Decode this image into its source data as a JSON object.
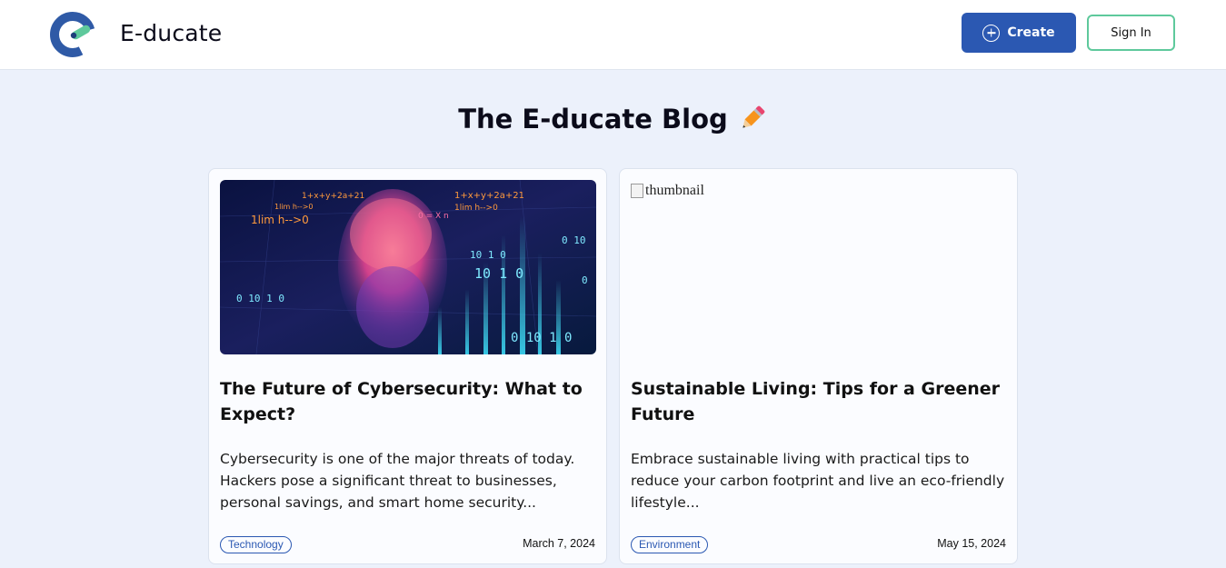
{
  "header": {
    "brand": "E-ducate",
    "create_label": "Create",
    "signin_label": "Sign In"
  },
  "page": {
    "title": "The E-ducate Blog"
  },
  "posts": [
    {
      "title": "The Future of Cybersecurity: What to Expect?",
      "excerpt": "Cybersecurity is one of the major threats of today. Hackers pose a significant threat to businesses, personal savings, and smart home security...",
      "tag": "Technology",
      "date": "March 7, 2024",
      "thumbnail": "cyber-face-image"
    },
    {
      "title": "Sustainable Living: Tips for a Greener Future",
      "excerpt": "Embrace sustainable living with practical tips to reduce your carbon footprint and live an eco-friendly lifestyle...",
      "tag": "Environment",
      "date": "May 15, 2024",
      "thumbnail_alt": "thumbnail"
    }
  ],
  "colors": {
    "primary": "#2b58b2",
    "accent": "#5ec99c",
    "background": "#ecf1fb"
  }
}
